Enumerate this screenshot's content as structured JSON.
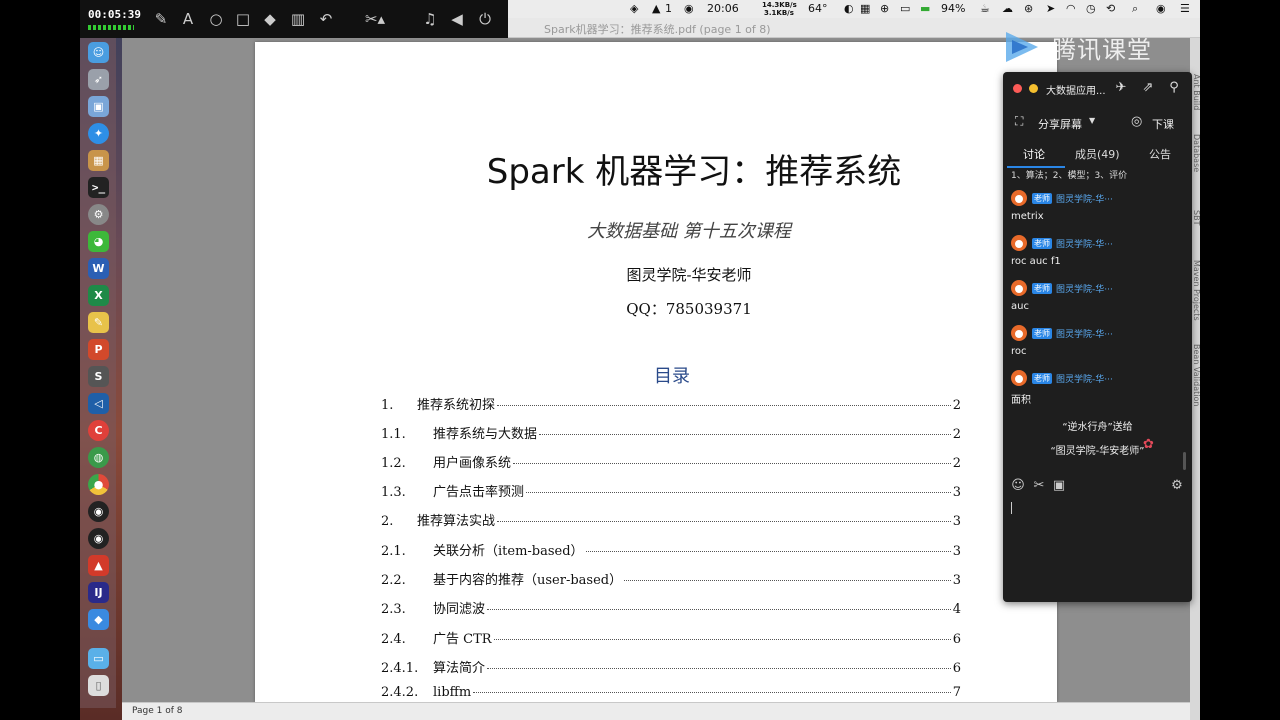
{
  "recorder": {
    "time": "00:05:39"
  },
  "menubar": {
    "clock": "20:06",
    "net_up": "14.3KB/s",
    "net_down": "3.1KB/s",
    "temp": "64°",
    "battery": "94%",
    "notif_count": "1"
  },
  "window": {
    "title": "Spark机器学习：推荐系统.pdf (page 1 of 8)"
  },
  "status": {
    "page": "Page 1 of 8"
  },
  "document": {
    "title": "Spark 机器学习：推荐系统",
    "subtitle": "大数据基础 第十五次课程",
    "author": "图灵学院-华安老师",
    "qq": "QQ：785039371",
    "toc_heading": "目录",
    "toc": [
      {
        "num": "1.",
        "text": "推荐系统初探",
        "page": "2",
        "level": 1
      },
      {
        "num": "1.1.",
        "text": "推荐系统与大数据",
        "page": "2",
        "level": 2
      },
      {
        "num": "1.2.",
        "text": "用户画像系统",
        "page": "2",
        "level": 2
      },
      {
        "num": "1.3.",
        "text": "广告点击率预测",
        "page": "3",
        "level": 2
      },
      {
        "num": "2.",
        "text": "推荐算法实战",
        "page": "3",
        "level": 1
      },
      {
        "num": "2.1.",
        "text": "关联分析（item-based）",
        "page": "3",
        "level": 2
      },
      {
        "num": "2.2.",
        "text": "基于内容的推荐（user-based）",
        "page": "3",
        "level": 2
      },
      {
        "num": "2.3.",
        "text": "协同滤波",
        "page": "4",
        "level": 2
      },
      {
        "num": "2.4.",
        "text": "广告 CTR",
        "page": "6",
        "level": 2
      },
      {
        "num": "2.4.1.",
        "text": "算法简介",
        "page": "6",
        "level": 2
      },
      {
        "num": "2.4.2.",
        "text": "libffm",
        "page": "7",
        "level": 2
      }
    ]
  },
  "logo": {
    "text": "腾讯课堂"
  },
  "chat": {
    "title": "大数据应用...",
    "share_label": "分享屏幕",
    "end_label": "下课",
    "tabs": [
      "讨论",
      "成员(49)",
      "公告"
    ],
    "topic": "1、算法；2、模型；3、评价",
    "badge": "老师",
    "messages": [
      {
        "sender": "图灵学院-华···",
        "text": "metrix"
      },
      {
        "sender": "图灵学院-华···",
        "text": "roc auc f1"
      },
      {
        "sender": "图灵学院-华···",
        "text": "auc"
      },
      {
        "sender": "图灵学院-华···",
        "text": "roc"
      },
      {
        "sender": "图灵学院-华···",
        "text": "面积"
      }
    ],
    "gift_line1": "“逆水行舟”送给",
    "gift_line2": "“图灵学院-华安老师”"
  },
  "side_labels": [
    "Ant Build",
    "Database",
    "SBT",
    "Maven Projects",
    "Bean Validation"
  ],
  "colors": {
    "accent": "#2a86e6",
    "chat_bg": "#1e1e1e",
    "toc_heading": "#2a4a8a"
  }
}
